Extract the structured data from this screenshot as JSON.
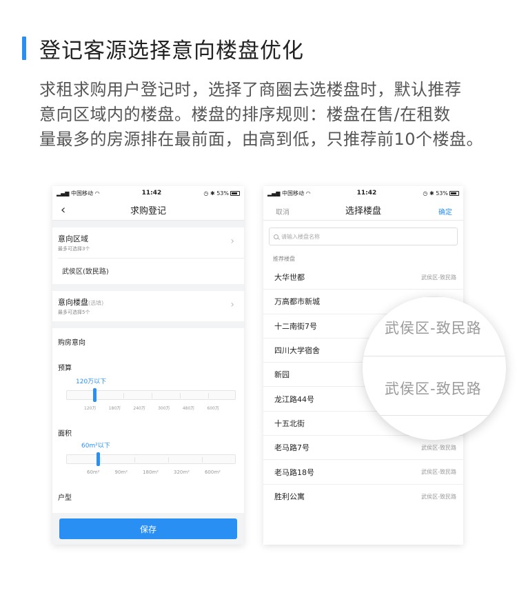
{
  "heading": {
    "title": "登记客源选择意向楼盘优化"
  },
  "description": {
    "lines": [
      "求租求购用户登记时，选择了商圈去选楼盘时，默认推荐",
      "意向区域内的楼盘。楼盘的排序规则：楼盘在售/在租数",
      "量最多的房源排在最前面，由高到低，只推荐前10个楼盘。"
    ]
  },
  "status_bar": {
    "carrier": "中国移动",
    "time": "11:42",
    "battery": "53%"
  },
  "left_screen": {
    "nav_title": "求购登记",
    "intended_area": {
      "label": "意向区域",
      "hint": "最多可选择3个",
      "value": "武侯区(致民路)"
    },
    "intended_estate": {
      "label": "意向楼盘",
      "optional": "(选填)",
      "hint": "最多可选择5个"
    },
    "purchase_intent_label": "购房意向",
    "budget": {
      "label": "预算",
      "value": "120万以下",
      "value_fraction": 0.16,
      "ticks": [
        "120万",
        "180万",
        "240万",
        "300万",
        "480万",
        "600万"
      ]
    },
    "area_size": {
      "label": "面积",
      "value": "60m²以下",
      "value_fraction": 0.18,
      "ticks": [
        "60m²",
        "90m²",
        "180m²",
        "320m²",
        "600m²"
      ]
    },
    "layout_label": "户型",
    "save_label": "保存"
  },
  "right_screen": {
    "cancel_label": "取消",
    "nav_title": "选择楼盘",
    "confirm_label": "确定",
    "search_placeholder": "请输入楼盘名称",
    "recommended_label": "推荐楼盘",
    "estates": [
      {
        "name": "大华世都",
        "area": "武侯区-致民路"
      },
      {
        "name": "万高都市新城",
        "area": ""
      },
      {
        "name": "十二南街7号",
        "area": ""
      },
      {
        "name": "四川大学宿舍",
        "area": ""
      },
      {
        "name": "新园",
        "area": ""
      },
      {
        "name": "龙江路44号",
        "area": ""
      },
      {
        "name": "十五北街",
        "area": ""
      },
      {
        "name": "老马路7号",
        "area": "武侯区-致民路"
      },
      {
        "name": "老马路18号",
        "area": "武侯区-致民路"
      },
      {
        "name": "胜利公寓",
        "area": "武侯区-致民路"
      }
    ]
  },
  "magnifier": {
    "texts": [
      "武侯区-致民路",
      "武侯区-致民路"
    ]
  },
  "colors": {
    "accent": "#2a8ff2",
    "page_background": "#ffffff",
    "screen_background": "#f2f3f5"
  }
}
